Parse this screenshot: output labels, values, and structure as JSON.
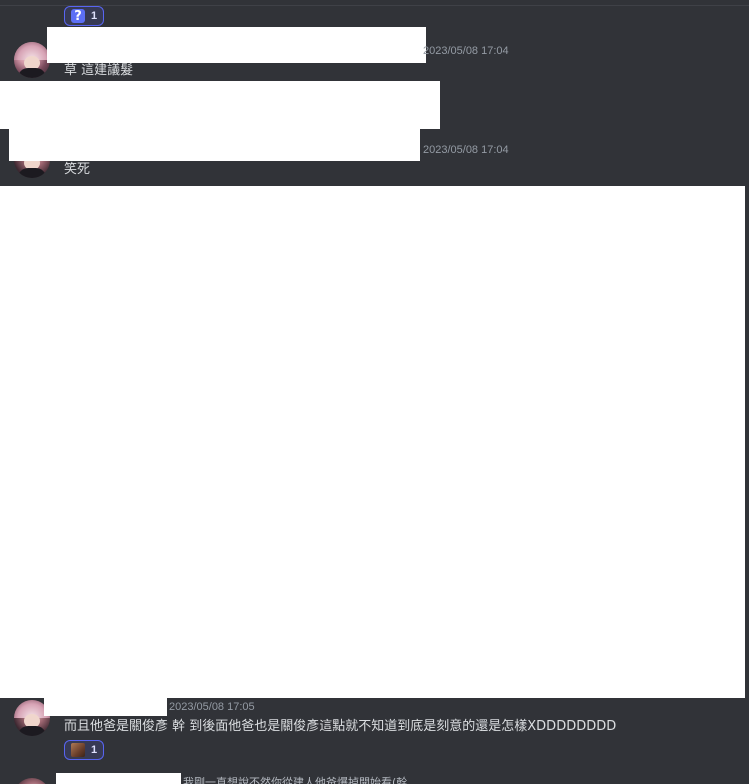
{
  "reactions": [
    {
      "emoji": "?",
      "count": "1",
      "emoji_name": "question-emoji"
    },
    {
      "emoji": "",
      "count": "1",
      "emoji_name": "custom-face-emoji"
    }
  ],
  "messages": [
    {
      "timestamp": "2023/05/08 17:04",
      "text": "草 這建議髮"
    },
    {
      "timestamp": "2023/05/08 17:04",
      "text": "笑死"
    },
    {
      "timestamp": "2023/05/08 17:05",
      "text": "而且他爸是關俊彥 幹 到後面他爸也是關俊彥這點就不知道到底是刻意的還是怎樣XDDDDDDDD"
    }
  ],
  "reply_preview": {
    "text": "我剛一直想說不然你從建人他爸爆掉開始看(幹"
  },
  "colors": {
    "background": "#313338",
    "timestamp": "#949ba4",
    "message_text": "#dbdee1",
    "reaction_border": "#5865f2",
    "reaction_bg": "#373a54",
    "redaction": "#ffffff"
  }
}
